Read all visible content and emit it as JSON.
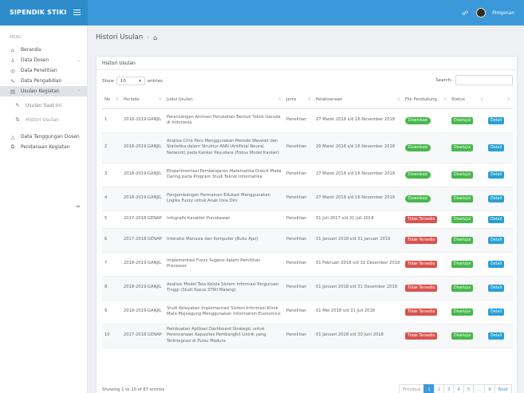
{
  "app": {
    "brand": "SIPENDIK STIKI",
    "user_name": "Pimpinan"
  },
  "sidebar": {
    "menu_heading": "MENU",
    "items": [
      {
        "label": "Beranda",
        "icon": "home-icon",
        "glyph": "⌂"
      },
      {
        "label": "Data Dosen",
        "icon": "user-icon",
        "glyph": "♙"
      },
      {
        "label": "Data Penelitian",
        "icon": "globe-icon",
        "glyph": "◎"
      },
      {
        "label": "Data Pengabdian",
        "icon": "pencil-icon",
        "glyph": "✎"
      },
      {
        "label": "Usulan Kegiatan",
        "icon": "document-icon",
        "glyph": "▤"
      },
      {
        "label": "Usulan Saat Ini",
        "icon": "pencil-icon",
        "glyph": "✎"
      },
      {
        "label": "Histori Usulan",
        "icon": "sort-icon",
        "glyph": "⇅"
      },
      {
        "label": "Data Tanggungan Dosen",
        "icon": "warning-icon",
        "glyph": "△"
      },
      {
        "label": "Pendanaan Kegiatan",
        "icon": "copy-icon",
        "glyph": "⧉"
      }
    ]
  },
  "breadcrumb": {
    "title": "Histori Usulan",
    "home_icon": "home-icon"
  },
  "panel": {
    "title": "Histori Usulan",
    "show_label": "Show",
    "show_value": "10",
    "entries_label": "entries",
    "search_label": "Search:"
  },
  "table": {
    "columns": [
      "No",
      "Periode",
      "Judul Usulan",
      "Jenis",
      "Pelaksanaan",
      "File Pendukung",
      "Status",
      ""
    ],
    "rows": [
      {
        "no": "1",
        "periode": "2018-2019 GANJIL",
        "judul": "Perancangan Animasi Perubahan Bentuk Tokoh Garuda di Indonesia",
        "jenis": "Penelitian",
        "pelaksanaan": "27 Maret 2018 s/d 16 November 2018",
        "file": "Download",
        "file_color": "#47b84b",
        "status": "Disetujui",
        "action": "Detail"
      },
      {
        "no": "2",
        "periode": "2018-2019 GANJIL",
        "judul": "Analisa Citra Paru Menggunakan Metode Wavelet dan Statistika dalam Struktur ANN (Artificial Neural Network) pada Kanker Payudara (Fokus Model Kanker)",
        "jenis": "Penelitian",
        "pelaksanaan": "20 Maret 2018 s/d 16 November 2018",
        "file": "Download",
        "file_color": "#47b84b",
        "status": "Disetujui",
        "action": "Detail"
      },
      {
        "no": "3",
        "periode": "2018-2019 GANJIL",
        "judul": "Eksperimentasi Pembelajaran Matematika Diskrit Moda Daring pada Program Studi Teknik Informatika",
        "jenis": "Penelitian",
        "pelaksanaan": "27 Maret 2018 s/d 16 November 2018",
        "file": "Download",
        "file_color": "#47b84b",
        "status": "Disetujui",
        "action": "Detail"
      },
      {
        "no": "4",
        "periode": "2018-2019 GANJIL",
        "judul": "Pengembangan Permainan Edukasi Menggunakan Logika Fuzzy untuk Anak Usia Dini",
        "jenis": "Penelitian",
        "pelaksanaan": "27 Maret 2018 s/d 16 November 2018",
        "file": "Download",
        "file_color": "#47b84b",
        "status": "Disetujui",
        "action": "Detail"
      },
      {
        "no": "5",
        "periode": "2017-2018 GENAP",
        "judul": "Infografis Karakter Punokawan",
        "jenis": "Penelitian",
        "pelaksanaan": "01 Juli 2017 s/d 31 Juli 2018",
        "file": "Tidak Tersedia",
        "file_color": "#d9534f",
        "status": "Disetujui",
        "action": "Detail"
      },
      {
        "no": "6",
        "periode": "2017-2018 GENAP",
        "judul": "Interaksi Manusia dan Komputer (Buku Ajar)",
        "jenis": "Penelitian",
        "pelaksanaan": "01 Januari 2018 s/d 31 Januari 2019",
        "file": "Tidak Tersedia",
        "file_color": "#d9534f",
        "status": "Disetujui",
        "action": "Detail"
      },
      {
        "no": "7",
        "periode": "2018-2019 GANJIL",
        "judul": "Implementasi Fuzzy Sugeno dalam Pemilihan Processor",
        "jenis": "Penelitian",
        "pelaksanaan": "01 Februari 2018 s/d 31 Desember 2018",
        "file": "Tidak Tersedia",
        "file_color": "#d9534f",
        "status": "Disetujui",
        "action": "Detail"
      },
      {
        "no": "8",
        "periode": "2018-2019 GANJIL",
        "judul": "Analisis Model Tata Kelola Sistem Informasi Perguruan Tinggi (Studi Kasus STIKI Malang)",
        "jenis": "Penelitian",
        "pelaksanaan": "01 Januari 2018 s/d 31 Desember 2018",
        "file": "Tidak Tersedia",
        "file_color": "#d9534f",
        "status": "Disetujui",
        "action": "Detail"
      },
      {
        "no": "9",
        "periode": "2018-2019 GANJIL",
        "judul": "Studi Kelayakan Implementasi Sistem Informasi Klinik Mata Mojoagung Menggunakan Information Economics",
        "jenis": "Penelitian",
        "pelaksanaan": "01 Mei 2018 s/d 31 Juli 2018",
        "file": "Tidak Tersedia",
        "file_color": "#d9534f",
        "status": "Disetujui",
        "action": "Detail"
      },
      {
        "no": "10",
        "periode": "2017-2018 GENAP",
        "judul": "Pembuatan Aplikasi Dashboard Strategic untuk Perencanaan Kapasitas Pembangkit Listrik yang Terintegrasi di Pulau Madura",
        "jenis": "Penelitian",
        "pelaksanaan": "01 Januari 2018 s/d 30 Juni 2018",
        "file": "Tidak Tersedia",
        "file_color": "#d9534f",
        "status": "Disetujui",
        "action": "Detail"
      }
    ]
  },
  "footer": {
    "info": "Showing 1 to 10 of 87 entries",
    "pager": [
      "Previous",
      "1",
      "2",
      "3",
      "4",
      "5",
      "...",
      "9",
      "Next"
    ],
    "active_page": "1"
  },
  "colors": {
    "topbar": "#3b99d9",
    "brand_bg": "#2f8ccb",
    "green": "#47b84b",
    "red": "#d9534f",
    "blue": "#2a9fd6"
  }
}
